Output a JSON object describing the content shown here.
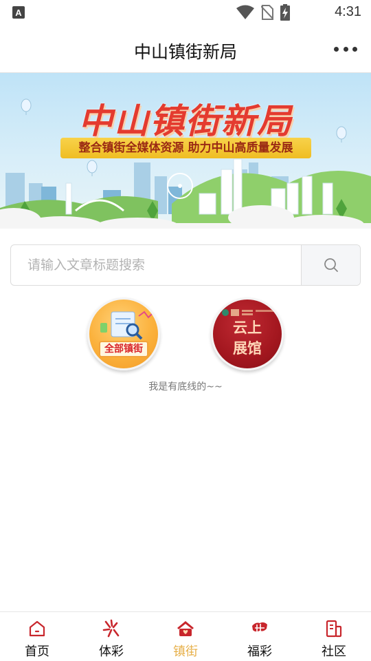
{
  "status_bar": {
    "time": "4:31",
    "left_icon": "a-letter-icon",
    "icons": [
      "wifi-icon",
      "no-sim-icon",
      "battery-charging-icon"
    ]
  },
  "header": {
    "title": "中山镇街新局",
    "more_icon": "more-dots-icon"
  },
  "banner": {
    "title": "中山镇街新局",
    "subtitle": "整合镇街全媒体资源 助力中山高质量发展"
  },
  "search": {
    "placeholder": "请输入文章标题搜索",
    "value": "",
    "button_icon": "search-icon"
  },
  "entries": {
    "all": {
      "label": "全部镇街"
    },
    "cloud": {
      "line1": "云上",
      "line2": "展馆"
    }
  },
  "footer_text": "我是有底线的~~",
  "colors": {
    "active": "#e7b04a",
    "icon_red": "#c8262c",
    "title_red": "#e43b2f"
  },
  "bottom_nav": {
    "items": [
      {
        "label": "首页",
        "icon": "home-icon",
        "active": false
      },
      {
        "label": "体彩",
        "icon": "sports-lottery-icon",
        "active": false
      },
      {
        "label": "镇街",
        "icon": "town-house-icon",
        "active": true
      },
      {
        "label": "福彩",
        "icon": "welfare-lottery-icon",
        "active": false
      },
      {
        "label": "社区",
        "icon": "community-icon",
        "active": false
      }
    ]
  }
}
